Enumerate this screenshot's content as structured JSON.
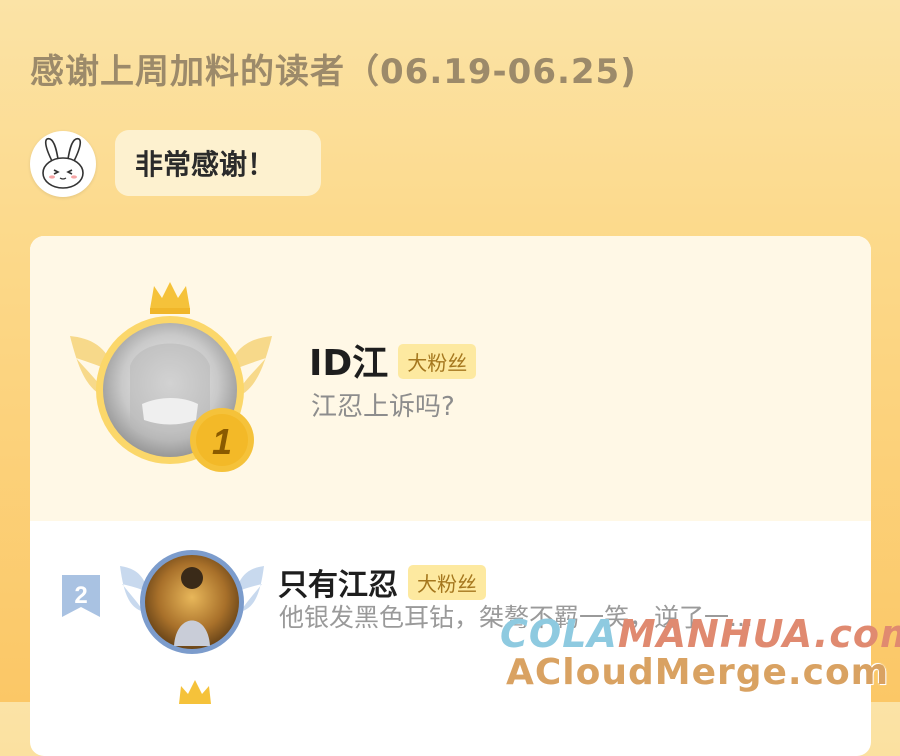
{
  "header": {
    "title": "感谢上周加料的读者（06.19-06.25)"
  },
  "mascot_bubble": {
    "text": "非常感谢！"
  },
  "rankings": [
    {
      "rank": "1",
      "name": "ID江",
      "badge": "大粉丝",
      "message": "江忍上诉吗?"
    },
    {
      "rank": "2",
      "name": "只有江忍",
      "badge": "大粉丝",
      "message": "他银发黑色耳钻，桀骜不羁一笑，逆了一..."
    }
  ],
  "watermark": {
    "line1_part1": "COLA",
    "line1_part2": "MANHUA",
    "line1_part3": ".com",
    "line2": "ACloudMerge.com"
  },
  "colors": {
    "gold": "#f5c23a",
    "silver_blue": "#8fb0d8",
    "badge_bg": "#fde9a0"
  }
}
